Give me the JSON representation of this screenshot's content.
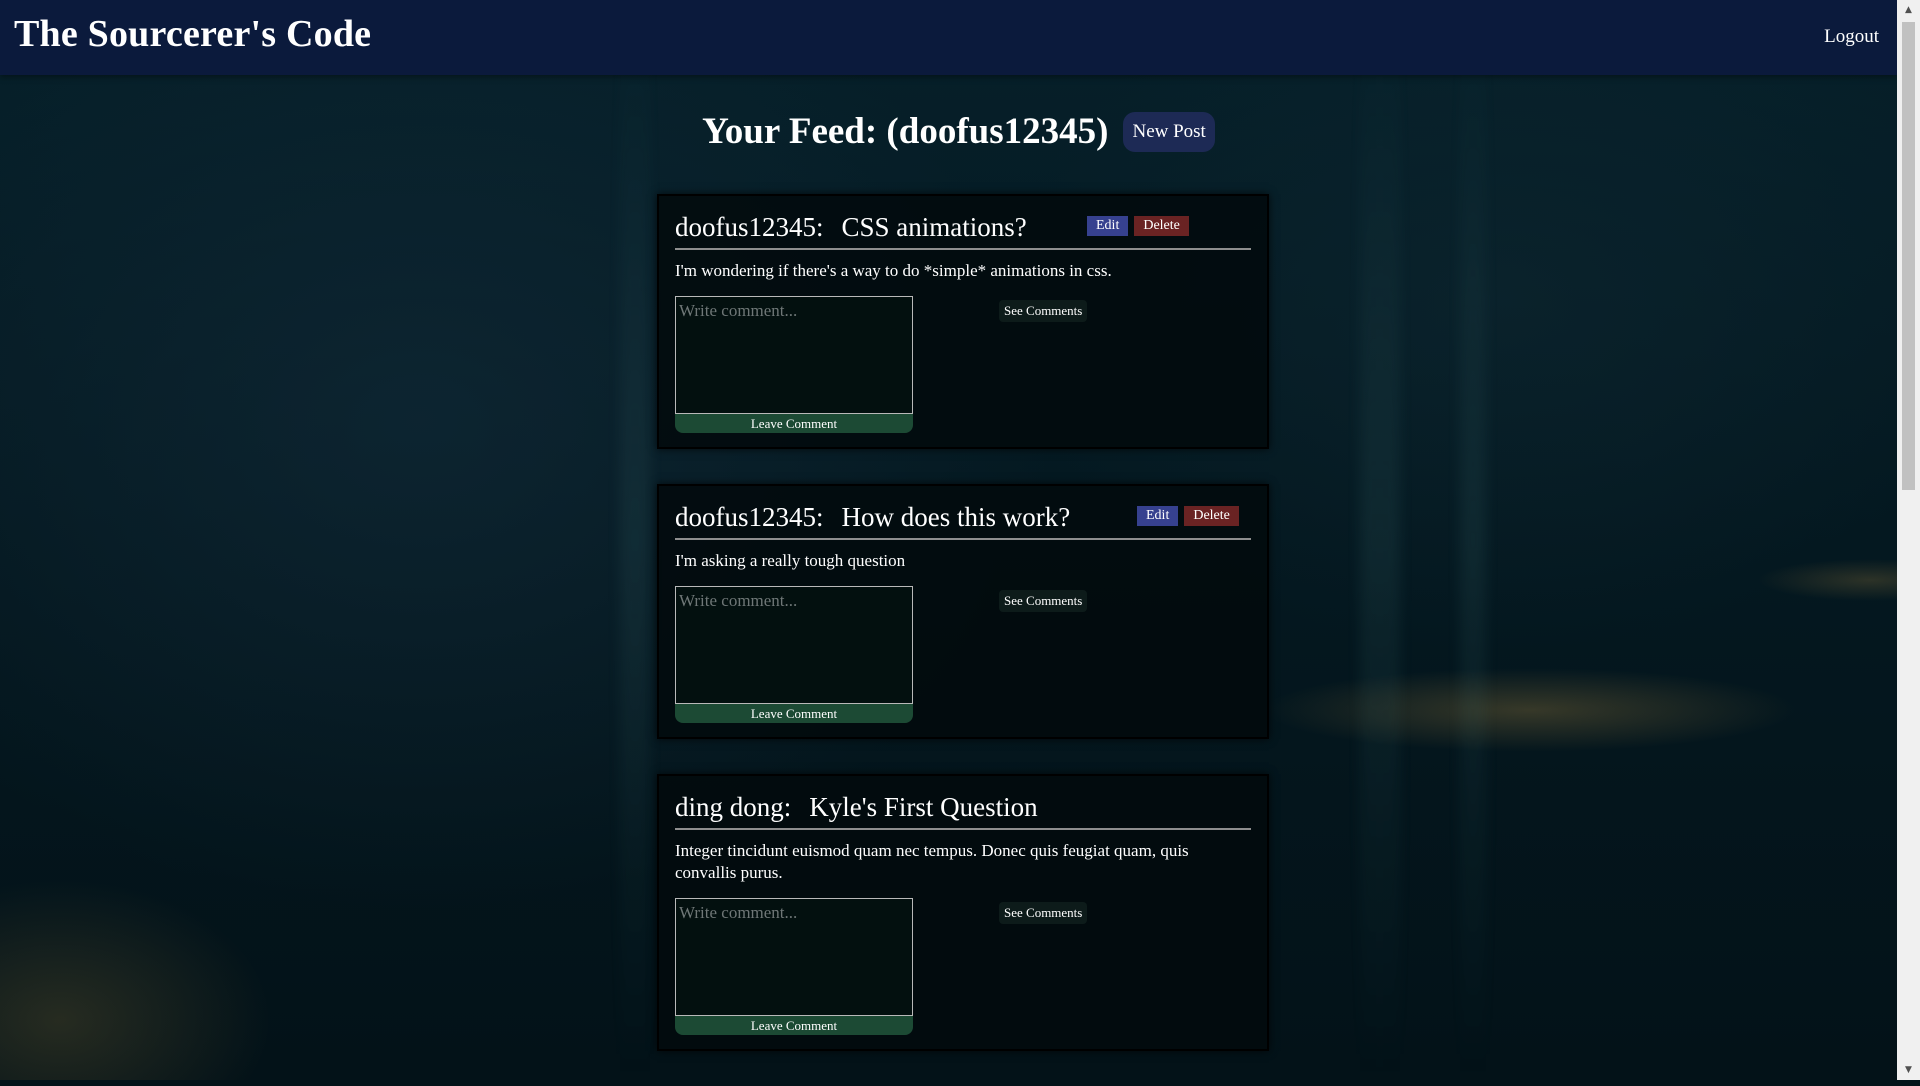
{
  "header": {
    "site_title": "The Sourcerer's Code",
    "logout_label": "Logout"
  },
  "feed": {
    "title": "Your Feed: (doofus12345)",
    "new_post_label": "New Post"
  },
  "posts": [
    {
      "author": "doofus12345:",
      "title": "CSS animations?",
      "body": "I'm wondering if there's a way to do *simple* animations in css.",
      "edit_label": "Edit",
      "delete_label": "Delete",
      "comment_placeholder": "Write comment...",
      "leave_comment_label": "Leave Comment",
      "see_comments_label": "See Comments"
    },
    {
      "author": "doofus12345:",
      "title": "How does this work?",
      "body": "I'm asking a really tough question",
      "edit_label": "Edit",
      "delete_label": "Delete",
      "comment_placeholder": "Write comment...",
      "leave_comment_label": "Leave Comment",
      "see_comments_label": "See Comments"
    },
    {
      "author": "ding dong:",
      "title": "Kyle's First Question",
      "body": "Integer tincidunt euismod quam nec tempus. Donec quis feugiat quam, quis convallis purus.",
      "comment_placeholder": "Write comment...",
      "leave_comment_label": "Leave Comment",
      "see_comments_label": "See Comments"
    }
  ],
  "scrollbar": {
    "up_icon": "triangle-up-icon",
    "down_icon": "triangle-down-icon"
  },
  "colors": {
    "navbar": "#0b1a3c",
    "edit_button": "#36418f",
    "delete_button": "#6a2323",
    "leave_comment_button": "#1c4a34",
    "new_post_button": "#1d2a55"
  }
}
